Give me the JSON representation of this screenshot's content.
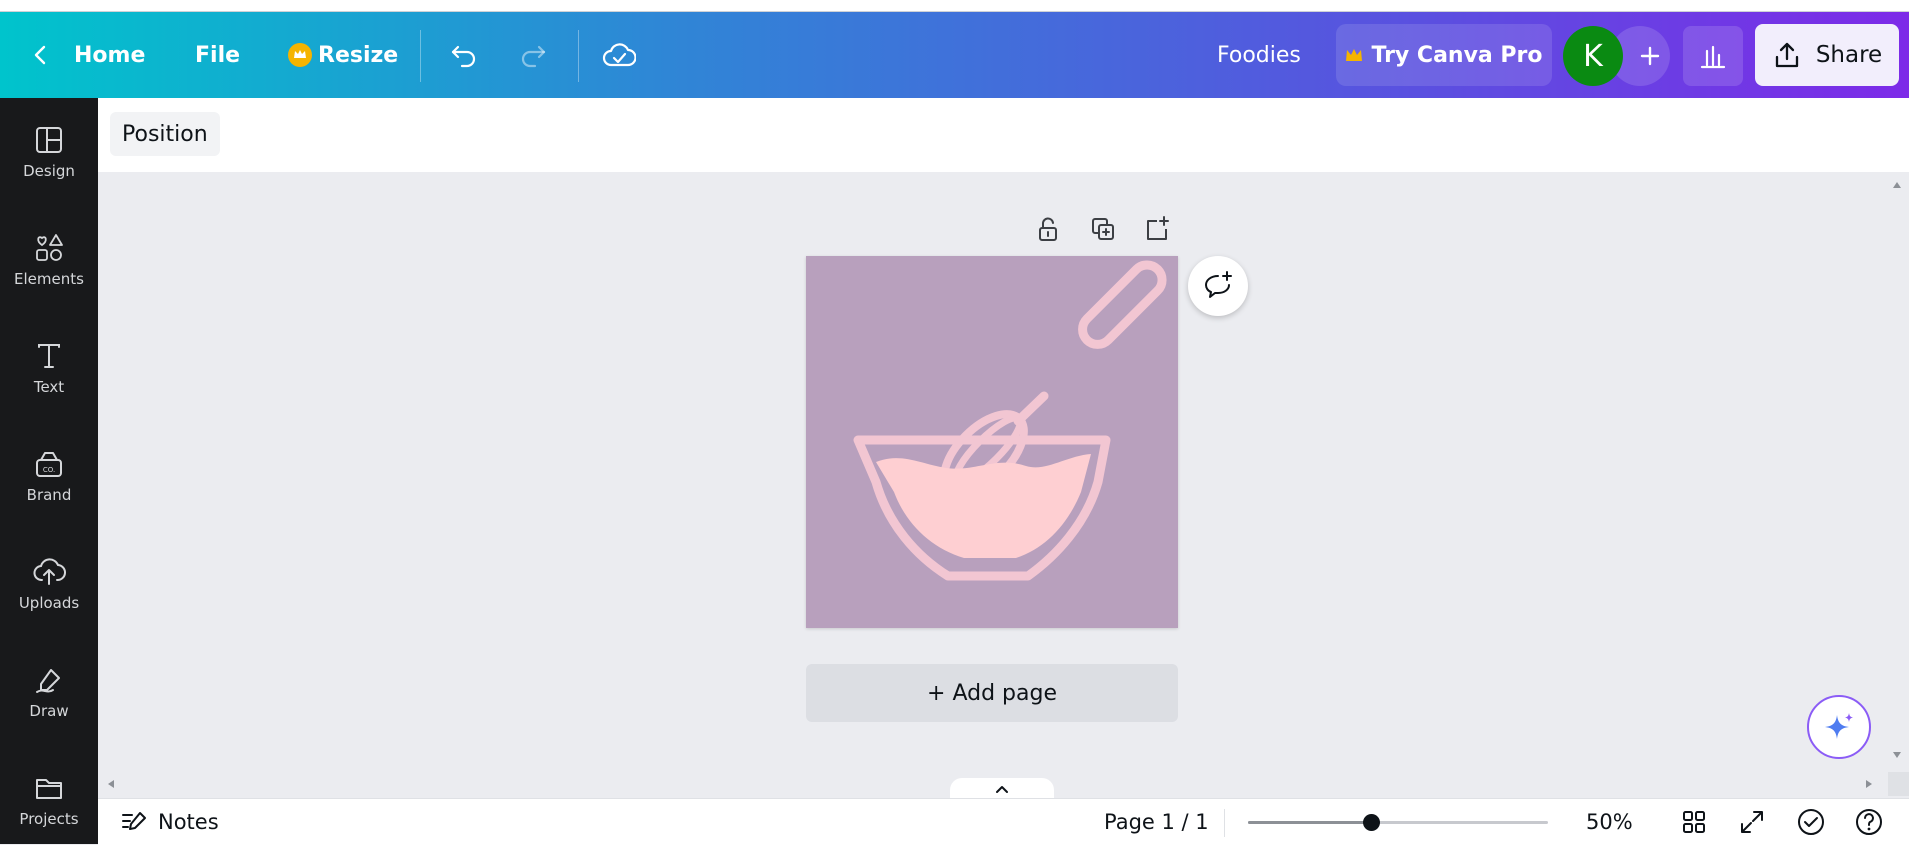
{
  "topbar": {
    "home_label": "Home",
    "file_label": "File",
    "resize_label": "Resize",
    "project_name": "Foodies",
    "try_pro_label": "Try Canva Pro",
    "avatar_initial": "K",
    "share_label": "Share",
    "colors": {
      "gradient_start": "#00c4cc",
      "gradient_end": "#7d2ae8",
      "avatar_bg": "#0a8a12",
      "crown": "#f5b400"
    }
  },
  "sidebar": {
    "items": [
      {
        "label": "Design",
        "icon": "design-icon"
      },
      {
        "label": "Elements",
        "icon": "elements-icon"
      },
      {
        "label": "Text",
        "icon": "text-icon"
      },
      {
        "label": "Brand",
        "icon": "brand-icon"
      },
      {
        "label": "Uploads",
        "icon": "uploads-icon"
      },
      {
        "label": "Draw",
        "icon": "draw-icon"
      },
      {
        "label": "Projects",
        "icon": "projects-icon"
      }
    ]
  },
  "context_bar": {
    "position_label": "Position"
  },
  "canvas": {
    "add_page_label": "+ Add page",
    "page_background": "#b8a0bd",
    "graphic": "whisk-bowl-illustration"
  },
  "bottombar": {
    "notes_label": "Notes",
    "page_indicator": "Page 1 / 1",
    "zoom_label": "50%",
    "zoom_value": 0.41
  }
}
